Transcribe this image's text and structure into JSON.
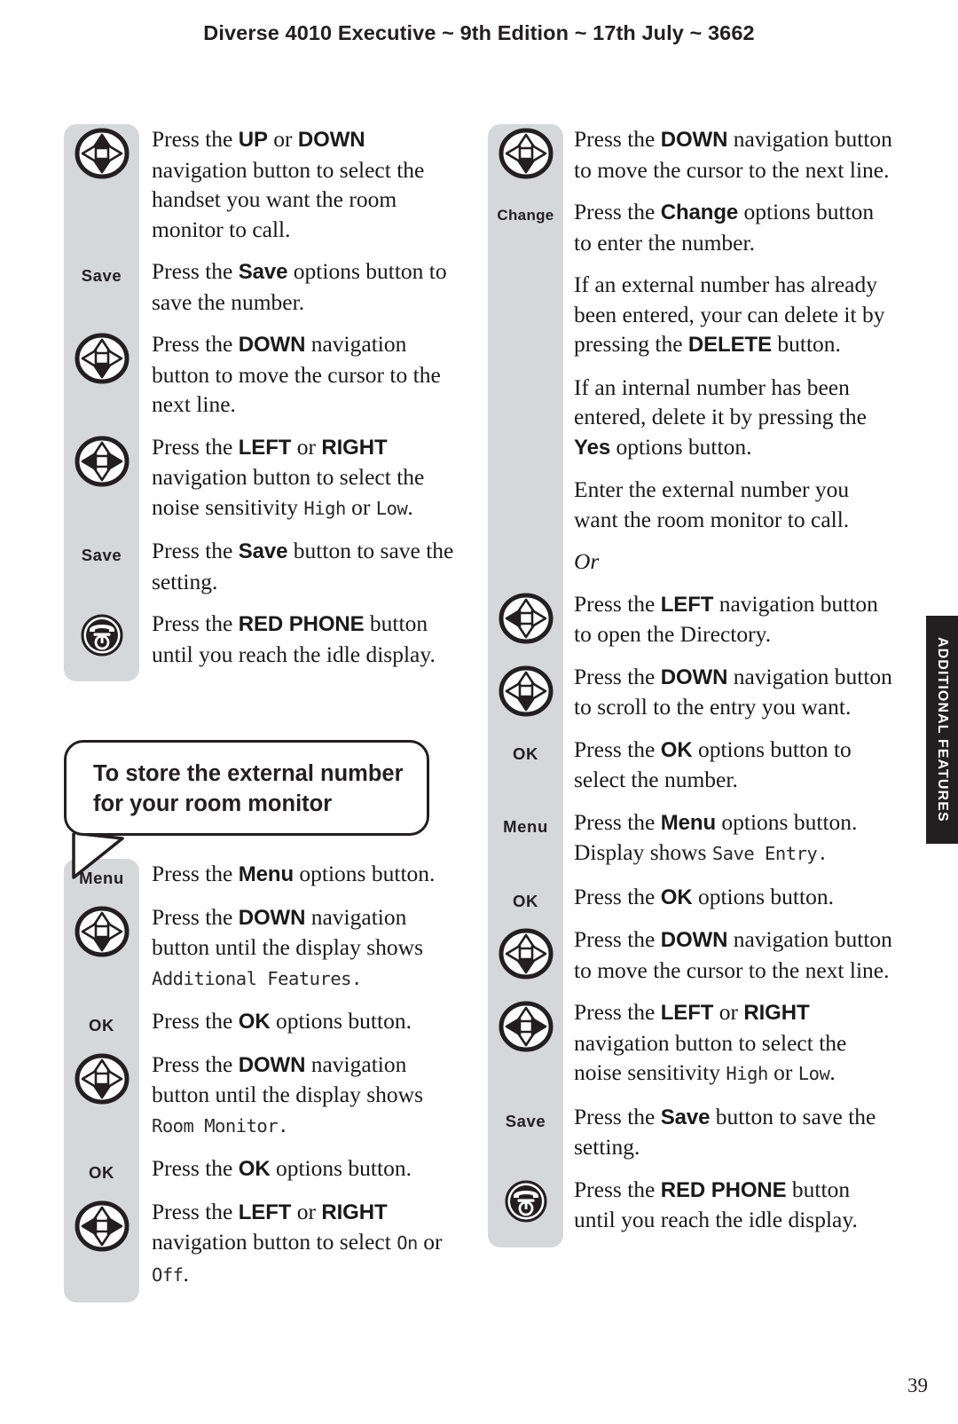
{
  "header": {
    "title": "Diverse 4010 Executive ~ 9th Edition ~ 17th July ~ 3662"
  },
  "side_tab": {
    "label": "ADDITIONAL FEATURES"
  },
  "page_number": "39",
  "colors": {
    "rail": "#d6d7d9",
    "ink": "#231f20",
    "tab_bg": "#231f20",
    "tab_text": "#ffffff",
    "page_bg": "#ffffff"
  },
  "callout": {
    "line1": "To store the external number",
    "line2": "for your room monitor"
  },
  "left_column": {
    "group1": [
      {
        "marker_type": "nav",
        "marker_icon": "nav-up-down-icon",
        "marker_label": "",
        "parts": [
          {
            "t": "Press the ",
            "s": "plain"
          },
          {
            "t": "UP",
            "s": "bold"
          },
          {
            "t": " or ",
            "s": "plain"
          },
          {
            "t": "DOWN",
            "s": "bold"
          },
          {
            "t": " navigation button to select the handset you want the room monitor to call.",
            "s": "plain"
          }
        ]
      },
      {
        "marker_type": "key",
        "marker_icon": "",
        "marker_label": "Save",
        "parts": [
          {
            "t": "Press the ",
            "s": "plain"
          },
          {
            "t": "Save",
            "s": "bold"
          },
          {
            "t": " options button to save the number.",
            "s": "plain"
          }
        ]
      },
      {
        "marker_type": "nav",
        "marker_icon": "nav-down-icon",
        "marker_label": "",
        "parts": [
          {
            "t": "Press the ",
            "s": "plain"
          },
          {
            "t": "DOWN",
            "s": "bold"
          },
          {
            "t": " navigation button to move the cursor to the next line.",
            "s": "plain"
          }
        ]
      },
      {
        "marker_type": "nav",
        "marker_icon": "nav-left-right-icon",
        "marker_label": "",
        "parts": [
          {
            "t": "Press the ",
            "s": "plain"
          },
          {
            "t": "LEFT",
            "s": "bold"
          },
          {
            "t": " or ",
            "s": "plain"
          },
          {
            "t": "RIGHT",
            "s": "bold"
          },
          {
            "t": " navigation button to select the noise sensitivity ",
            "s": "plain"
          },
          {
            "t": "High",
            "s": "lcd"
          },
          {
            "t": " or ",
            "s": "plain"
          },
          {
            "t": "Low",
            "s": "lcd"
          },
          {
            "t": ".",
            "s": "plain"
          }
        ]
      },
      {
        "marker_type": "key",
        "marker_icon": "",
        "marker_label": "Save",
        "parts": [
          {
            "t": "Press the ",
            "s": "plain"
          },
          {
            "t": "Save",
            "s": "bold"
          },
          {
            "t": " button to save the setting.",
            "s": "plain"
          }
        ]
      },
      {
        "marker_type": "phone",
        "marker_icon": "red-phone-icon",
        "marker_label": "",
        "parts": [
          {
            "t": "Press the ",
            "s": "plain"
          },
          {
            "t": "RED PHONE",
            "s": "bold"
          },
          {
            "t": " button until you reach the idle display.",
            "s": "plain"
          }
        ]
      }
    ],
    "group2": [
      {
        "marker_type": "key",
        "marker_icon": "",
        "marker_label": "Menu",
        "parts": [
          {
            "t": "Press the ",
            "s": "plain"
          },
          {
            "t": "Menu",
            "s": "bold"
          },
          {
            "t": " options button.",
            "s": "plain"
          }
        ]
      },
      {
        "marker_type": "nav",
        "marker_icon": "nav-down-icon",
        "marker_label": "",
        "parts": [
          {
            "t": "Press the ",
            "s": "plain"
          },
          {
            "t": "DOWN",
            "s": "bold"
          },
          {
            "t": " navigation button until the display shows ",
            "s": "plain"
          },
          {
            "t": "Additional Features.",
            "s": "lcd"
          }
        ]
      },
      {
        "marker_type": "key",
        "marker_icon": "",
        "marker_label": "OK",
        "parts": [
          {
            "t": "Press the ",
            "s": "plain"
          },
          {
            "t": "OK",
            "s": "bold"
          },
          {
            "t": " options button.",
            "s": "plain"
          }
        ]
      },
      {
        "marker_type": "nav",
        "marker_icon": "nav-down-icon",
        "marker_label": "",
        "parts": [
          {
            "t": "Press the ",
            "s": "plain"
          },
          {
            "t": "DOWN",
            "s": "bold"
          },
          {
            "t": " navigation button until the display shows ",
            "s": "plain"
          },
          {
            "t": "Room Monitor.",
            "s": "lcd"
          }
        ]
      },
      {
        "marker_type": "key",
        "marker_icon": "",
        "marker_label": "OK",
        "parts": [
          {
            "t": "Press the ",
            "s": "plain"
          },
          {
            "t": "OK",
            "s": "bold"
          },
          {
            "t": " options button.",
            "s": "plain"
          }
        ]
      },
      {
        "marker_type": "nav",
        "marker_icon": "nav-left-right-icon",
        "marker_label": "",
        "parts": [
          {
            "t": "Press the ",
            "s": "plain"
          },
          {
            "t": "LEFT",
            "s": "bold"
          },
          {
            "t": " or ",
            "s": "plain"
          },
          {
            "t": "RIGHT",
            "s": "bold"
          },
          {
            "t": " navigation button to select ",
            "s": "plain"
          },
          {
            "t": "On",
            "s": "lcd"
          },
          {
            "t": " or ",
            "s": "plain"
          },
          {
            "t": "Off",
            "s": "lcd"
          },
          {
            "t": ".",
            "s": "plain"
          }
        ]
      }
    ]
  },
  "right_column": {
    "group1": [
      {
        "marker_type": "nav",
        "marker_icon": "nav-down-icon",
        "marker_label": "",
        "parts": [
          {
            "t": "Press the ",
            "s": "plain"
          },
          {
            "t": "DOWN",
            "s": "bold"
          },
          {
            "t": " navigation button to move the cursor to the next line.",
            "s": "plain"
          }
        ]
      },
      {
        "marker_type": "key",
        "marker_icon": "",
        "marker_label": "Change",
        "parts": [
          {
            "t": "Press the ",
            "s": "plain"
          },
          {
            "t": "Change",
            "s": "bold"
          },
          {
            "t": " options button to enter the number.",
            "s": "plain"
          }
        ]
      },
      {
        "marker_type": "none",
        "marker_icon": "",
        "marker_label": "",
        "parts": [
          {
            "t": "If an external number has already been entered, your can delete it by pressing the ",
            "s": "plain"
          },
          {
            "t": "DELETE",
            "s": "bold"
          },
          {
            "t": " button.",
            "s": "plain"
          }
        ]
      },
      {
        "marker_type": "none",
        "marker_icon": "",
        "marker_label": "",
        "parts": [
          {
            "t": "If an internal number has been entered, delete it by pressing the ",
            "s": "plain"
          },
          {
            "t": "Yes",
            "s": "bold"
          },
          {
            "t": " options button.",
            "s": "plain"
          }
        ]
      },
      {
        "marker_type": "none",
        "marker_icon": "",
        "marker_label": "",
        "parts": [
          {
            "t": "Enter the external number you want the room monitor to call.",
            "s": "plain"
          }
        ]
      },
      {
        "marker_type": "none",
        "marker_icon": "",
        "marker_label": "",
        "parts": [
          {
            "t": "Or",
            "s": "italic"
          }
        ]
      },
      {
        "marker_type": "nav",
        "marker_icon": "nav-left-icon",
        "marker_label": "",
        "parts": [
          {
            "t": "Press the ",
            "s": "plain"
          },
          {
            "t": "LEFT",
            "s": "bold"
          },
          {
            "t": " navigation button to open the Directory.",
            "s": "plain"
          }
        ]
      },
      {
        "marker_type": "nav",
        "marker_icon": "nav-down-icon",
        "marker_label": "",
        "parts": [
          {
            "t": "Press the ",
            "s": "plain"
          },
          {
            "t": "DOWN",
            "s": "bold"
          },
          {
            "t": " navigation button to scroll to the entry you want.",
            "s": "plain"
          }
        ]
      },
      {
        "marker_type": "key",
        "marker_icon": "",
        "marker_label": "OK",
        "parts": [
          {
            "t": "Press the ",
            "s": "plain"
          },
          {
            "t": "OK",
            "s": "bold"
          },
          {
            "t": " options button to select the number.",
            "s": "plain"
          }
        ]
      },
      {
        "marker_type": "key",
        "marker_icon": "",
        "marker_label": "Menu",
        "parts": [
          {
            "t": "Press the ",
            "s": "plain"
          },
          {
            "t": "Menu",
            "s": "bold"
          },
          {
            "t": " options button. Display shows ",
            "s": "plain"
          },
          {
            "t": "Save Entry.",
            "s": "lcd"
          }
        ]
      },
      {
        "marker_type": "key",
        "marker_icon": "",
        "marker_label": "OK",
        "parts": [
          {
            "t": "Press the ",
            "s": "plain"
          },
          {
            "t": "OK",
            "s": "bold"
          },
          {
            "t": " options button.",
            "s": "plain"
          }
        ]
      },
      {
        "marker_type": "nav",
        "marker_icon": "nav-down-icon",
        "marker_label": "",
        "parts": [
          {
            "t": "Press the ",
            "s": "plain"
          },
          {
            "t": "DOWN",
            "s": "bold"
          },
          {
            "t": " navigation button to move the cursor to the next line.",
            "s": "plain"
          }
        ]
      },
      {
        "marker_type": "nav",
        "marker_icon": "nav-left-right-icon",
        "marker_label": "",
        "parts": [
          {
            "t": "Press the ",
            "s": "plain"
          },
          {
            "t": "LEFT",
            "s": "bold"
          },
          {
            "t": " or ",
            "s": "plain"
          },
          {
            "t": "RIGHT",
            "s": "bold"
          },
          {
            "t": " navigation button to select the noise sensitivity ",
            "s": "plain"
          },
          {
            "t": "High",
            "s": "lcd"
          },
          {
            "t": " or ",
            "s": "plain"
          },
          {
            "t": "Low",
            "s": "lcd"
          },
          {
            "t": ".",
            "s": "plain"
          }
        ]
      },
      {
        "marker_type": "key",
        "marker_icon": "",
        "marker_label": "Save",
        "parts": [
          {
            "t": "Press the ",
            "s": "plain"
          },
          {
            "t": "Save",
            "s": "bold"
          },
          {
            "t": " button to save the setting.",
            "s": "plain"
          }
        ]
      },
      {
        "marker_type": "phone",
        "marker_icon": "red-phone-icon",
        "marker_label": "",
        "parts": [
          {
            "t": "Press the ",
            "s": "plain"
          },
          {
            "t": "RED PHONE",
            "s": "bold"
          },
          {
            "t": " button until you reach the idle display.",
            "s": "plain"
          }
        ]
      }
    ]
  }
}
